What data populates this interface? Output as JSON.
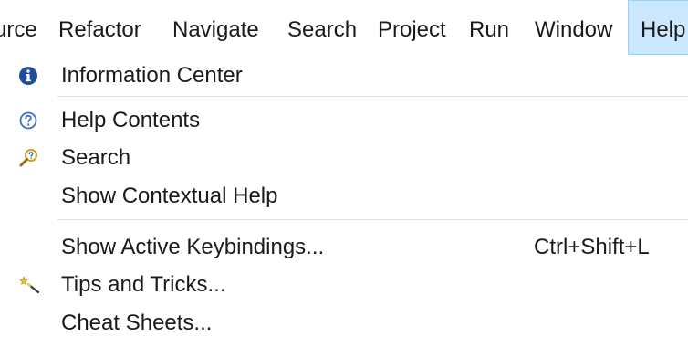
{
  "menubar": {
    "items": [
      {
        "label": "urce"
      },
      {
        "label": "Refactor"
      },
      {
        "label": "Navigate"
      },
      {
        "label": "Search"
      },
      {
        "label": "Project"
      },
      {
        "label": "Run"
      },
      {
        "label": "Window"
      },
      {
        "label": "Help"
      }
    ],
    "active_item": "Help"
  },
  "help_menu": {
    "items": [
      {
        "label": "Information Center",
        "icon": "info-icon",
        "shortcut": ""
      },
      {
        "label": "Help Contents",
        "icon": "help-contents-icon",
        "shortcut": ""
      },
      {
        "label": "Search",
        "icon": "help-search-icon",
        "shortcut": ""
      },
      {
        "label": "Show Contextual Help",
        "icon": "",
        "shortcut": ""
      },
      {
        "label": "Show Active Keybindings...",
        "icon": "",
        "shortcut": "Ctrl+Shift+L"
      },
      {
        "label": "Tips and Tricks...",
        "icon": "tips-and-tricks-icon",
        "shortcut": ""
      },
      {
        "label": "Cheat Sheets...",
        "icon": "",
        "shortcut": ""
      }
    ]
  },
  "colors": {
    "active_menu_background": "#cce8ff",
    "active_menu_border": "#99d1ff",
    "info_icon": "#1f4d9c",
    "help_icon": "#3b6fc7"
  }
}
